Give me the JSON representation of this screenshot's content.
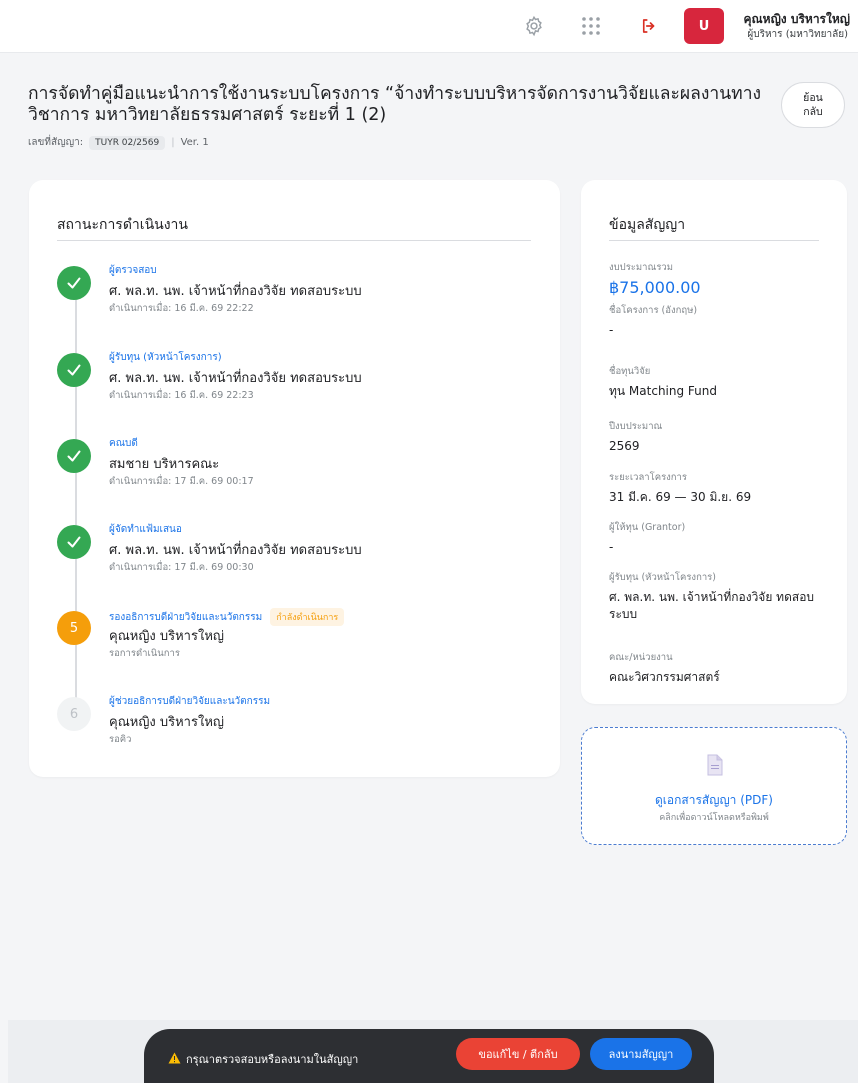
{
  "header": {
    "avatar_initial": "U",
    "user_name": "คุณหญิง บริหารใหญ่",
    "user_role": "ผู้บริหาร (มหาวิทยาลัย)"
  },
  "page": {
    "title": "การจัดทำคู่มือแนะนำการใช้งานระบบโครงการ “จ้างทำระบบบริหารจัดการงานวิจัยและผลงานทางวิชาการ มหาวิทยาลัยธรรมศาสตร์ ระยะที่ 1 (2)",
    "back_label": "ย้อน\nกลับ",
    "contract_label": "เลขที่สัญญา:",
    "contract_no": "TUYR 02/2569",
    "separator": "|",
    "version": "Ver. 1"
  },
  "status": {
    "heading": "สถานะการดำเนินงาน",
    "steps": [
      {
        "marker": "",
        "role": "ผู้ตรวจสอบ",
        "badge": "",
        "person": "ศ. พล.ท. นพ. เจ้าหน้าที่กองวิจัย ทดสอบระบบ",
        "time": "ดำเนินการเมื่อ: 16 มี.ค. 69 22:22",
        "state": "done"
      },
      {
        "marker": "",
        "role": "ผู้รับทุน (หัวหน้าโครงการ)",
        "badge": "",
        "person": "ศ. พล.ท. นพ. เจ้าหน้าที่กองวิจัย ทดสอบระบบ",
        "time": "ดำเนินการเมื่อ: 16 มี.ค. 69 22:23",
        "state": "done"
      },
      {
        "marker": "",
        "role": "คณบดี",
        "badge": "",
        "person": "สมชาย บริหารคณะ",
        "time": "ดำเนินการเมื่อ: 17 มี.ค. 69 00:17",
        "state": "done"
      },
      {
        "marker": "",
        "role": "ผู้จัดทำแฟ้มเสนอ",
        "badge": "",
        "person": "ศ. พล.ท. นพ. เจ้าหน้าที่กองวิจัย ทดสอบระบบ",
        "time": "ดำเนินการเมื่อ: 17 มี.ค. 69 00:30",
        "state": "done"
      },
      {
        "marker": "5",
        "role": "รองอธิการบดีฝ่ายวิจัยและนวัตกรรม",
        "badge": "กำลังดำเนินการ",
        "person": "คุณหญิง บริหารใหญ่",
        "time": "รอการดำเนินการ",
        "state": "active"
      },
      {
        "marker": "6",
        "role": "ผู้ช่วยอธิการบดีฝ่ายวิจัยและนวัตกรรม",
        "badge": "",
        "person": "คุณหญิง บริหารใหญ่",
        "time": "รอคิว",
        "state": "pending"
      }
    ]
  },
  "info": {
    "heading": "ข้อมูลสัญญา",
    "budget_label": "งบประมาณรวม",
    "budget_value": "฿75,000.00",
    "fields": [
      {
        "label": "ชื่อโครงการ (อังกฤษ)",
        "value": "-"
      },
      {
        "label": "ชื่อทุนวิจัย",
        "value": "ทุน Matching Fund"
      },
      {
        "label": "ปีงบประมาณ",
        "value": "2569"
      },
      {
        "label": "ระยะเวลาโครงการ",
        "value": "31 มี.ค. 69 — 30 มิ.ย. 69"
      },
      {
        "label": "ผู้ให้ทุน (Grantor)",
        "value": "-"
      },
      {
        "label": "ผู้รับทุน (หัวหน้าโครงการ)",
        "value": "ศ. พล.ท. นพ. เจ้าหน้าที่กองวิจัย ทดสอบระบบ"
      },
      {
        "label": "คณะ/หน่วยงาน",
        "value": "คณะวิศวกรรมศาสตร์"
      }
    ]
  },
  "pdf": {
    "title": "ดูเอกสารสัญญา (PDF)",
    "subtitle": "คลิกเพื่อดาวน์โหลดหรือพิมพ์"
  },
  "action_bar": {
    "warning": "กรุณาตรวจสอบหรือลงนามในสัญญา",
    "return_label": "ขอแก้ไข / ตีกลับ",
    "sign_label": "ลงนามสัญญา"
  },
  "colors": {
    "accent": "#1a73e8",
    "success": "#34a853",
    "warning": "#f59e0b",
    "danger": "#ea4335",
    "avatar": "#d7263d"
  }
}
